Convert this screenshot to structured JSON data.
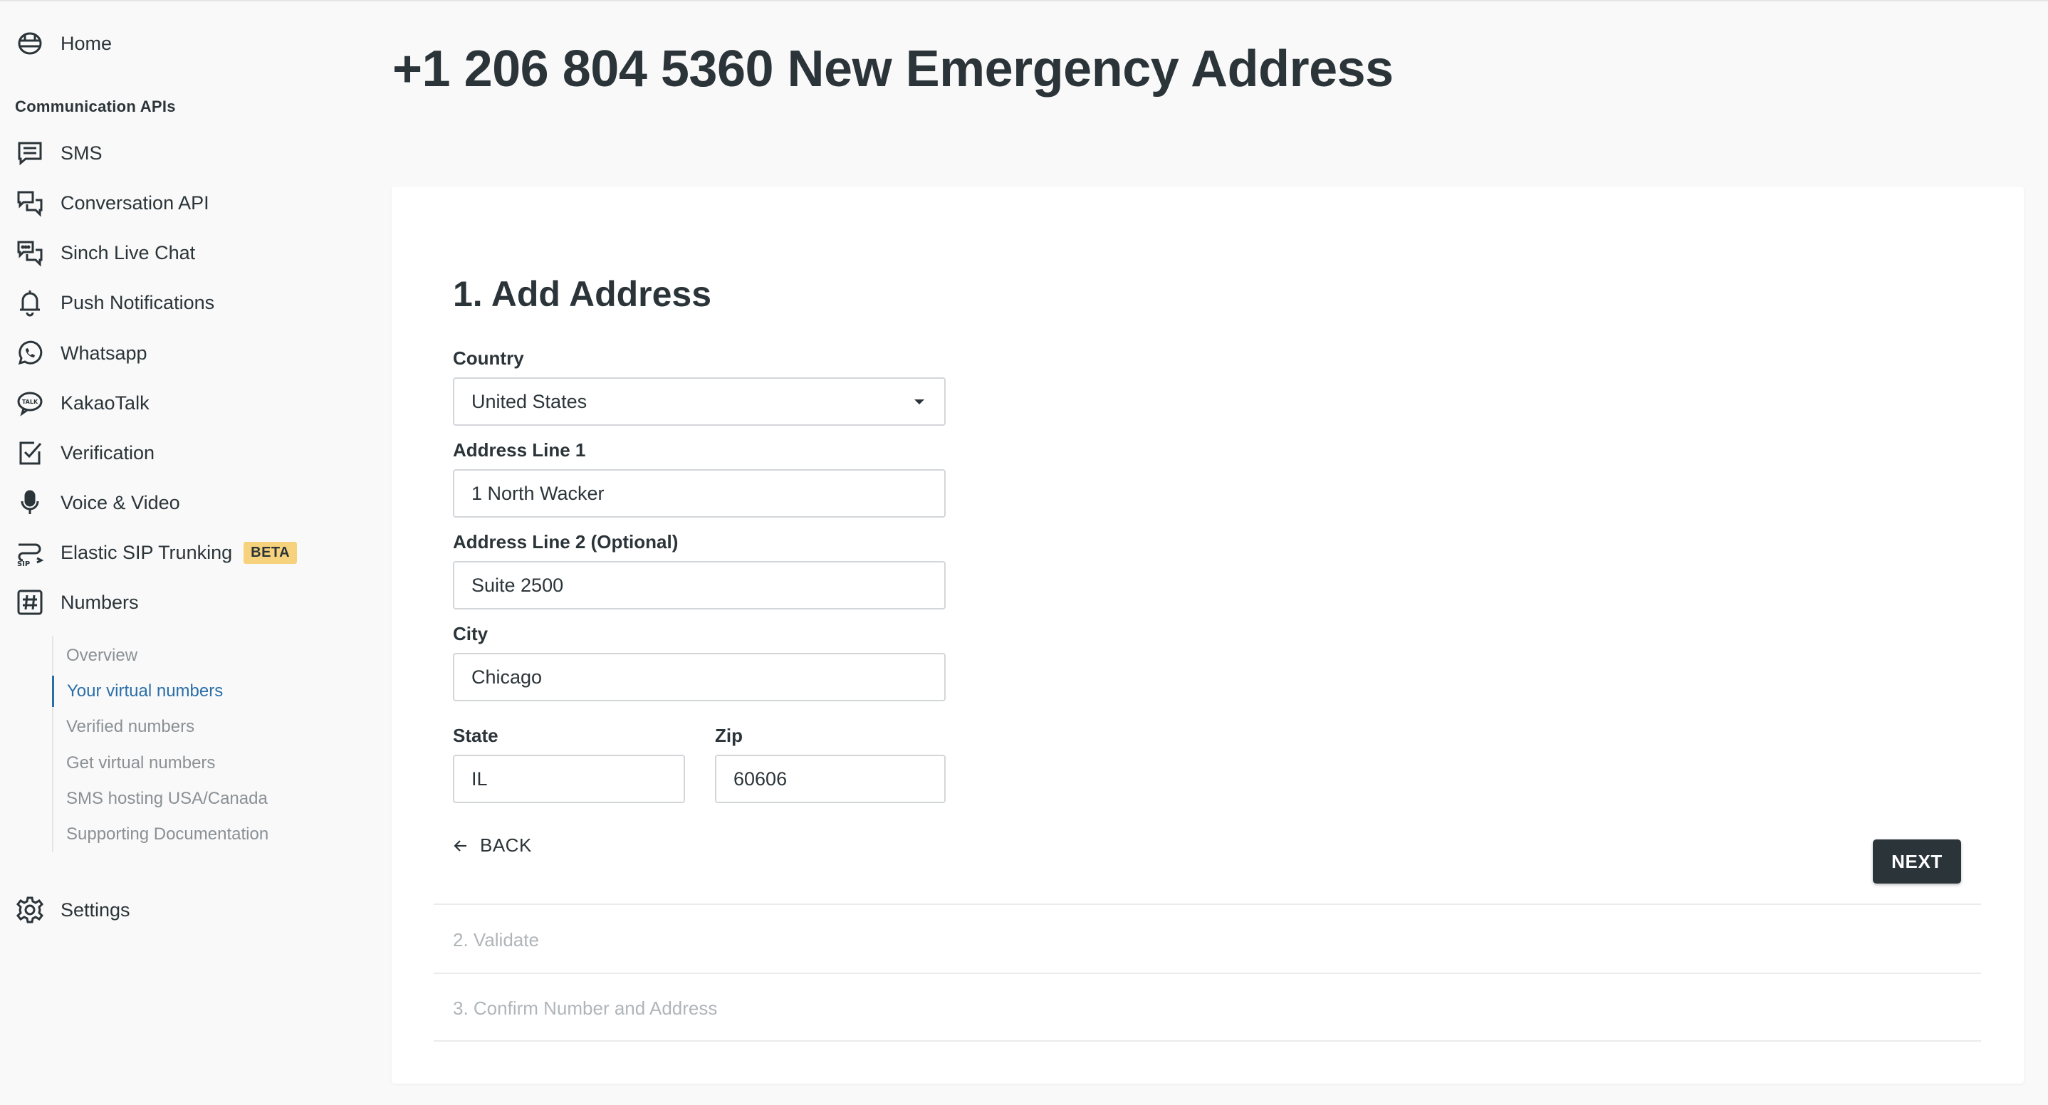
{
  "sidebar": {
    "home": "Home",
    "section_title": "Communication APIs",
    "items": [
      {
        "label": "SMS",
        "icon": "sms-icon"
      },
      {
        "label": "Conversation API",
        "icon": "conversation-icon"
      },
      {
        "label": "Sinch Live Chat",
        "icon": "live-chat-icon"
      },
      {
        "label": "Push Notifications",
        "icon": "bell-icon"
      },
      {
        "label": "Whatsapp",
        "icon": "whatsapp-icon"
      },
      {
        "label": "KakaoTalk",
        "icon": "kakaotalk-icon"
      },
      {
        "label": "Verification",
        "icon": "verification-check-icon"
      },
      {
        "label": "Voice & Video",
        "icon": "microphone-icon"
      },
      {
        "label": "Elastic SIP Trunking",
        "icon": "sip-icon",
        "badge": "BETA"
      },
      {
        "label": "Numbers",
        "icon": "hash-icon"
      }
    ],
    "numbers_subnav": [
      {
        "label": "Overview",
        "active": false
      },
      {
        "label": "Your virtual numbers",
        "active": true
      },
      {
        "label": "Verified numbers",
        "active": false
      },
      {
        "label": "Get virtual numbers",
        "active": false
      },
      {
        "label": "SMS hosting USA/Canada",
        "active": false
      },
      {
        "label": "Supporting Documentation",
        "active": false
      }
    ],
    "settings": "Settings"
  },
  "page": {
    "title": "+1 206 804 5360 New Emergency Address"
  },
  "form": {
    "step_title": "1. Add Address",
    "country_label": "Country",
    "country_value": "United States",
    "address1_label": "Address Line 1",
    "address1_value": "1 North Wacker",
    "address2_label": "Address Line 2 (Optional)",
    "address2_value": "Suite 2500",
    "city_label": "City",
    "city_value": "Chicago",
    "state_label": "State",
    "state_value": "IL",
    "zip_label": "Zip",
    "zip_value": "60606",
    "back_label": "BACK",
    "next_label": "NEXT"
  },
  "steps": {
    "validate": "2. Validate",
    "confirm": "3. Confirm Number and Address"
  },
  "colors": {
    "text_dark": "#2b3439",
    "active_link": "#2a6ea8",
    "beta_badge": "#f7d27c",
    "muted": "#b0b5b9"
  }
}
